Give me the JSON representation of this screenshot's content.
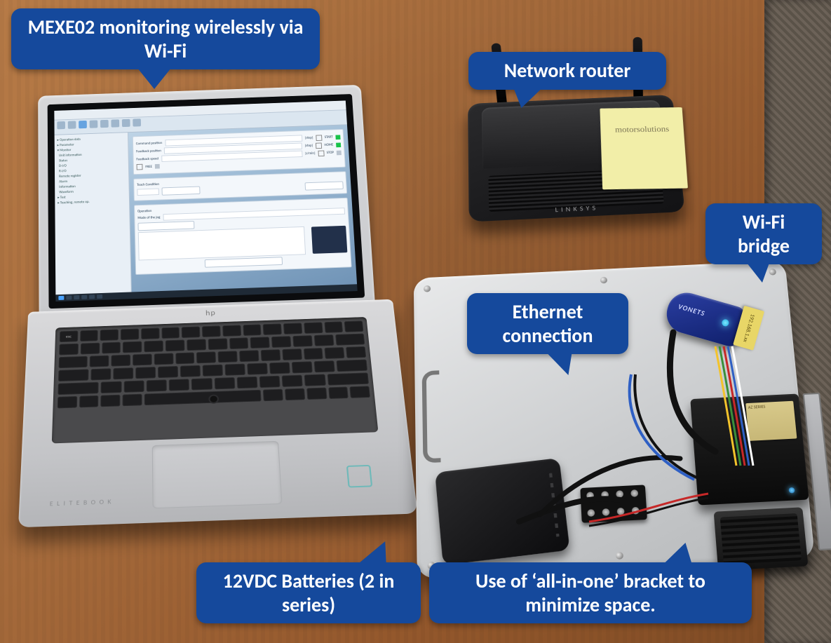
{
  "callouts": {
    "laptop": "MEXE02 monitoring wirelessly via Wi-Fi",
    "router": "Network router",
    "wifi_bridge": "Wi-Fi bridge",
    "ethernet": "Ethernet connection",
    "batteries": "12VDC Batteries (2 in series)",
    "bracket": "Use of ‘all-in-one’ bracket to minimize space."
  },
  "laptop": {
    "brand": "hp",
    "model_line": "ELITEBOOK"
  },
  "router": {
    "brand": "LINKSYS",
    "sticky_note": "motorsolutions"
  },
  "wifi_bridge": {
    "brand": "VONETS",
    "tape_label": "192.168.1.xx"
  },
  "driver_label": "AZ SERIES"
}
